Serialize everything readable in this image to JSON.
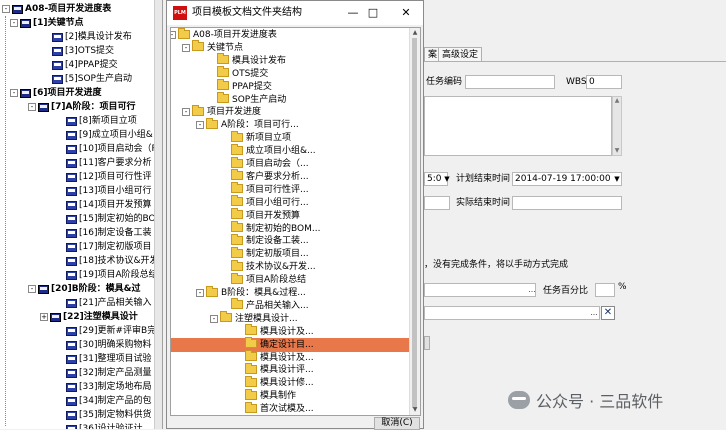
{
  "left_tree": {
    "root": "A08-项目开发进度表",
    "rows": [
      {
        "label": "[1]关键节点",
        "bold": true,
        "x": 22,
        "toggle": "-",
        "icon": "par"
      },
      {
        "label": "[2]模具设计发布",
        "x": 52,
        "icon": "doc"
      },
      {
        "label": "[3]OTS提交",
        "x": 52,
        "icon": "doc"
      },
      {
        "label": "[4]PPAP提交",
        "x": 52,
        "icon": "doc"
      },
      {
        "label": "[5]SOP生产启动",
        "x": 52,
        "icon": "doc"
      },
      {
        "label": "[6]项目开发进度",
        "bold": true,
        "x": 22,
        "toggle": "-",
        "icon": "par"
      },
      {
        "label": "[7]A阶段：项目可行",
        "bold": true,
        "x": 40,
        "toggle": "-",
        "icon": "par"
      },
      {
        "label": "[8]新项目立项",
        "x": 66,
        "icon": "doc"
      },
      {
        "label": "[9]成立项目小组&",
        "x": 66,
        "icon": "doc"
      },
      {
        "label": "[10]项目启动会（R",
        "x": 66,
        "icon": "doc"
      },
      {
        "label": "[11]客户要求分析",
        "x": 66,
        "icon": "doc"
      },
      {
        "label": "[12]项目可行性评",
        "x": 66,
        "icon": "doc"
      },
      {
        "label": "[13]项目小组可行",
        "x": 66,
        "icon": "doc"
      },
      {
        "label": "[14]项目开发预算",
        "x": 66,
        "icon": "doc"
      },
      {
        "label": "[15]制定初始的BOM",
        "x": 66,
        "icon": "doc"
      },
      {
        "label": "[16]制定设备工装",
        "x": 66,
        "icon": "doc"
      },
      {
        "label": "[17]制定初版项目",
        "x": 66,
        "icon": "doc"
      },
      {
        "label": "[18]技术协议&开发",
        "x": 66,
        "icon": "doc"
      },
      {
        "label": "[19]项目A阶段总结",
        "x": 66,
        "icon": "doc"
      },
      {
        "label": "[20]B阶段：模具&过",
        "bold": true,
        "x": 40,
        "toggle": "-",
        "icon": "par"
      },
      {
        "label": "[21]产品相关输入",
        "x": 66,
        "icon": "doc"
      },
      {
        "label": "[22]注塑模具设计",
        "bold": true,
        "x": 52,
        "toggle": "+",
        "icon": "par"
      },
      {
        "label": "[29]更新#评审B完",
        "x": 66,
        "icon": "doc"
      },
      {
        "label": "[30]明确采购物料",
        "x": 66,
        "icon": "doc"
      },
      {
        "label": "[31]整理项目试验",
        "x": 66,
        "icon": "doc"
      },
      {
        "label": "[32]制定产品测量",
        "x": 66,
        "icon": "doc"
      },
      {
        "label": "[33]制定场地布局",
        "x": 66,
        "icon": "doc"
      },
      {
        "label": "[34]制定产品的包",
        "x": 66,
        "icon": "doc"
      },
      {
        "label": "[35]制定物料供货",
        "x": 66,
        "icon": "doc"
      },
      {
        "label": "[36]设计验证计",
        "x": 66,
        "icon": "doc"
      }
    ]
  },
  "right_form": {
    "tabs": [
      "案",
      "高级设定"
    ],
    "task_code_label": "任务编码",
    "task_code_value": "",
    "wbs_label": "WBS",
    "wbs_value": "0",
    "time_partial": "5:0",
    "plan_end_label": "计划结束时间",
    "plan_end_value": "2014-07-19  17:00:00",
    "actual_end_label": "实际结束时间",
    "actual_end_value": "",
    "no_condition_text": "，没有完成条件，将以手动方式完成",
    "task_percent_label": "任务百分比",
    "percent_sign": "%"
  },
  "dialog": {
    "app_icon_text": "PLM",
    "title": "项目模板文档文件夹结构",
    "minimize": "—",
    "maximize": "□",
    "close": "✕",
    "cancel_label": "取消(C)",
    "tree": [
      {
        "label": "A08-项目开发进度表",
        "x": 4,
        "toggle": "-"
      },
      {
        "label": "关键节点",
        "x": 18,
        "toggle": "-"
      },
      {
        "label": "模具设计发布",
        "x": 42
      },
      {
        "label": "OTS提交",
        "x": 42
      },
      {
        "label": "PPAP提交",
        "x": 42
      },
      {
        "label": "SOP生产启动",
        "x": 42
      },
      {
        "label": "项目开发进度",
        "x": 18,
        "toggle": "-"
      },
      {
        "label": "A阶段：项目可行...",
        "x": 32,
        "toggle": "-"
      },
      {
        "label": "新项目立项",
        "x": 56
      },
      {
        "label": "成立项目小组&...",
        "x": 56
      },
      {
        "label": "项目启动会（...",
        "x": 56
      },
      {
        "label": "客户要求分析...",
        "x": 56
      },
      {
        "label": "项目可行性评...",
        "x": 56
      },
      {
        "label": "项目小组可行...",
        "x": 56
      },
      {
        "label": "项目开发预算",
        "x": 56
      },
      {
        "label": "制定初始的BOM...",
        "x": 56
      },
      {
        "label": "制定设备工装...",
        "x": 56
      },
      {
        "label": "制定初版项目...",
        "x": 56
      },
      {
        "label": "技术协议&开发...",
        "x": 56
      },
      {
        "label": "项目A阶段总结",
        "x": 56
      },
      {
        "label": "B阶段：模具&过程...",
        "x": 32,
        "toggle": "-"
      },
      {
        "label": "产品相关输入...",
        "x": 56
      },
      {
        "label": "注塑模具设计...",
        "x": 46,
        "toggle": "-"
      },
      {
        "label": "模具设计及...",
        "x": 70
      },
      {
        "label": "确定设计目...",
        "x": 70,
        "selected": true
      },
      {
        "label": "模具设计及...",
        "x": 70
      },
      {
        "label": "模具设计评...",
        "x": 70
      },
      {
        "label": "模具设计修...",
        "x": 70
      },
      {
        "label": "模具制作",
        "x": 70
      },
      {
        "label": "首次试模及...",
        "x": 70
      }
    ]
  },
  "watermark": {
    "text": "公众号 · 三品软件"
  }
}
